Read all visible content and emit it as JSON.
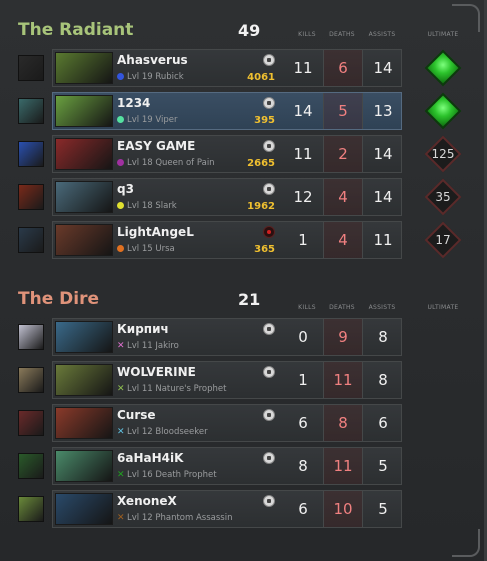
{
  "radiant": {
    "title": "The Radiant",
    "score": "49",
    "headers": {
      "kills": "KILLS",
      "deaths": "DEATHS",
      "assists": "ASSISTS",
      "ultimate": "ULTIMATE"
    },
    "players": [
      {
        "name": "Ahasverus",
        "hero": "Lvl 19 Rubick",
        "gold": "4061",
        "kills": "11",
        "deaths": "6",
        "assists": "14",
        "ult": "",
        "ult_state": "ready",
        "color": "#3355dd",
        "portrait": "#5a7a30",
        "icon": "#2a2a2a"
      },
      {
        "name": "1234",
        "hero": "Lvl 19 Viper",
        "gold": "395",
        "kills": "14",
        "deaths": "5",
        "assists": "13",
        "ult": "",
        "ult_state": "ready",
        "color": "#55e0a0",
        "portrait": "#6aa040",
        "icon": "#3a6a6a"
      },
      {
        "name": "EASY GAME",
        "hero": "Lvl 18 Queen of Pain",
        "gold": "2665",
        "kills": "11",
        "deaths": "2",
        "assists": "14",
        "ult": "125",
        "ult_state": "cooldown",
        "color": "#a030a0",
        "portrait": "#8a2a2a",
        "icon": "#2a50b0"
      },
      {
        "name": "q3",
        "hero": "Lvl 18 Slark",
        "gold": "1962",
        "kills": "12",
        "deaths": "4",
        "assists": "14",
        "ult": "35",
        "ult_state": "cooldown",
        "color": "#e0e030",
        "portrait": "#4a6a7a",
        "icon": "#7a2a1a"
      },
      {
        "name": "LightAngeL",
        "hero": "Lvl 15 Ursa",
        "gold": "365",
        "kills": "1",
        "deaths": "4",
        "assists": "11",
        "ult": "17",
        "ult_state": "cooldown",
        "color": "#e07020",
        "portrait": "#6a3a2a",
        "icon": "#2a3a4a"
      }
    ]
  },
  "dire": {
    "title": "The Dire",
    "score": "21",
    "headers": {
      "kills": "KILLS",
      "deaths": "DEATHS",
      "assists": "ASSISTS",
      "ultimate": "ULTIMATE"
    },
    "players": [
      {
        "name": "Кирпич",
        "hero": "Lvl 11 Jakiro",
        "kills": "0",
        "deaths": "9",
        "assists": "8",
        "color": "#e070d0",
        "portrait": "#3a6a8a",
        "icon": "#c0c0d0"
      },
      {
        "name": "WOLVERINE",
        "hero": "Lvl 11 Nature's Prophet",
        "kills": "1",
        "deaths": "11",
        "assists": "8",
        "color": "#90c050",
        "portrait": "#6a7a3a",
        "icon": "#8a7a5a"
      },
      {
        "name": "Curse",
        "hero": "Lvl 12 Bloodseeker",
        "kills": "6",
        "deaths": "8",
        "assists": "6",
        "color": "#60c0e0",
        "portrait": "#8a3a2a",
        "icon": "#6a2a2a"
      },
      {
        "name": "6aHaH4iK",
        "hero": "Lvl 16 Death Prophet",
        "kills": "8",
        "deaths": "11",
        "assists": "5",
        "color": "#20a020",
        "portrait": "#4a8a6a",
        "icon": "#2a5a2a"
      },
      {
        "name": "XenoneX",
        "hero": "Lvl 12 Phantom Assassin",
        "kills": "6",
        "deaths": "10",
        "assists": "5",
        "color": "#a06020",
        "portrait": "#2a4a6a",
        "icon": "#6a8a3a"
      }
    ]
  }
}
